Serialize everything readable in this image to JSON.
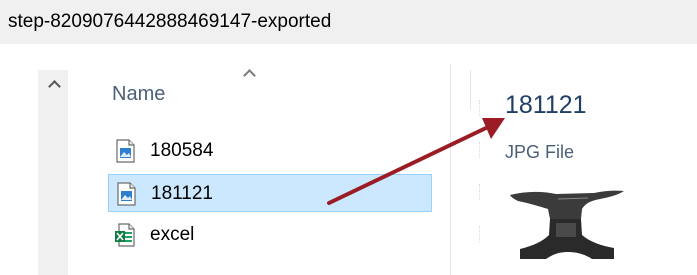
{
  "window": {
    "title": "step-8209076442888469147-exported"
  },
  "file_list": {
    "column_header": "Name",
    "sort_direction": "ascending",
    "items": [
      {
        "label": "180584",
        "type": "image"
      },
      {
        "label": "181121",
        "type": "image",
        "selected": true
      },
      {
        "label": "excel",
        "type": "excel"
      }
    ]
  },
  "details_pane": {
    "file_name": "181121",
    "file_type": "JPG File",
    "thumbnail": "anvil-image"
  },
  "colors": {
    "selection_fill": "#cce8ff",
    "selection_border": "#99d1ff",
    "annotation_arrow": "#9b1c24",
    "details_name": "#1e3f66"
  }
}
